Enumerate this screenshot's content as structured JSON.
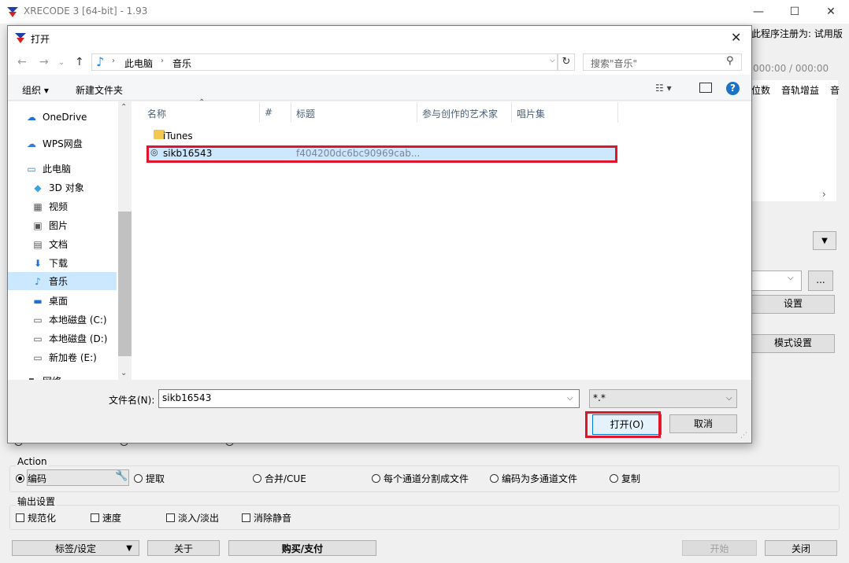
{
  "app": {
    "title": "XRECODE 3 [64-bit] - 1.93",
    "registration_text": "此程序注册为: 试用版",
    "time_display": "000:00 / 000:00",
    "list_headers": [
      "位数",
      "音轨增益",
      "音"
    ],
    "settings_button": "设置",
    "mode_settings_button": "模式设置",
    "browse_button": "...",
    "action": {
      "label": "Action",
      "options": [
        "编码",
        "提取",
        "合并/CUE",
        "每个通道分割成文件",
        "编码为多通道文件",
        "复制"
      ],
      "selected": "编码"
    },
    "output": {
      "label": "输出设置",
      "checks": [
        "规范化",
        "速度",
        "淡入/淡出",
        "消除静音"
      ]
    },
    "buttons": {
      "tags": "标签/设定",
      "about": "关于",
      "buy": "购买/支付",
      "start": "开始",
      "close": "关闭"
    }
  },
  "dialog": {
    "title": "打开",
    "breadcrumb": [
      "此电脑",
      "音乐"
    ],
    "search_placeholder": "搜索\"音乐\"",
    "toolbar": {
      "organize": "组织 ▾",
      "new_folder": "新建文件夹"
    },
    "nav": [
      {
        "label": "OneDrive",
        "icon": "cloud-icon"
      },
      {
        "label": "WPS网盘",
        "icon": "cloud-outline-icon"
      },
      {
        "label": "此电脑",
        "icon": "computer-icon"
      },
      {
        "label": "3D 对象",
        "icon": "cube-icon"
      },
      {
        "label": "视频",
        "icon": "video-icon"
      },
      {
        "label": "图片",
        "icon": "picture-icon"
      },
      {
        "label": "文档",
        "icon": "document-icon"
      },
      {
        "label": "下载",
        "icon": "download-icon"
      },
      {
        "label": "音乐",
        "icon": "music-icon"
      },
      {
        "label": "桌面",
        "icon": "desktop-icon"
      },
      {
        "label": "本地磁盘 (C:)",
        "icon": "drive-icon"
      },
      {
        "label": "本地磁盘 (D:)",
        "icon": "drive-icon"
      },
      {
        "label": "新加卷 (E:)",
        "icon": "drive-icon"
      },
      {
        "label": "网络",
        "icon": "network-icon"
      }
    ],
    "columns": [
      "名称",
      "#",
      "标题",
      "参与创作的艺术家",
      "唱片集"
    ],
    "files": [
      {
        "name": "iTunes",
        "title": ""
      },
      {
        "name": "sikb16543",
        "title": "f404200dc6bc90969cab..."
      }
    ],
    "filename_label": "文件名(N):",
    "filename_value": "sikb16543",
    "filter_value": "*.*",
    "open_button": "打开(O)",
    "cancel_button": "取消"
  }
}
